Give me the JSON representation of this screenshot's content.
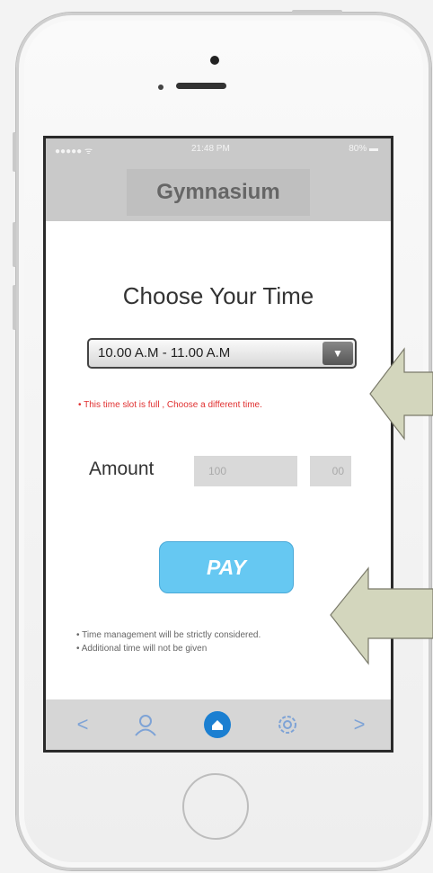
{
  "status_bar": {
    "signal": "●●●●● ᯤ",
    "time": "21:48 PM",
    "battery": "80% ▬"
  },
  "header": {
    "title": "Gymnasium"
  },
  "main": {
    "heading": "Choose Your Time",
    "time_select": {
      "value": "10.00 A.M - 11.00 A.M",
      "arrow": "▼"
    },
    "warning": "• This time slot is full , Choose a different time.",
    "amount": {
      "label": "Amount",
      "value": "100",
      "decimal": "00"
    },
    "pay_label": "PAY",
    "notes": [
      "• Time management will be strictly considered.",
      "• Additional time will not be given"
    ]
  },
  "tabbar": {
    "back": "<",
    "forward": ">",
    "icons": [
      "user-icon",
      "home-icon",
      "settings-icon"
    ]
  },
  "colors": {
    "pay": "#66c8f2",
    "home": "#1b7fd1",
    "warning": "#e03030",
    "arrows": "#d3d6bd"
  }
}
